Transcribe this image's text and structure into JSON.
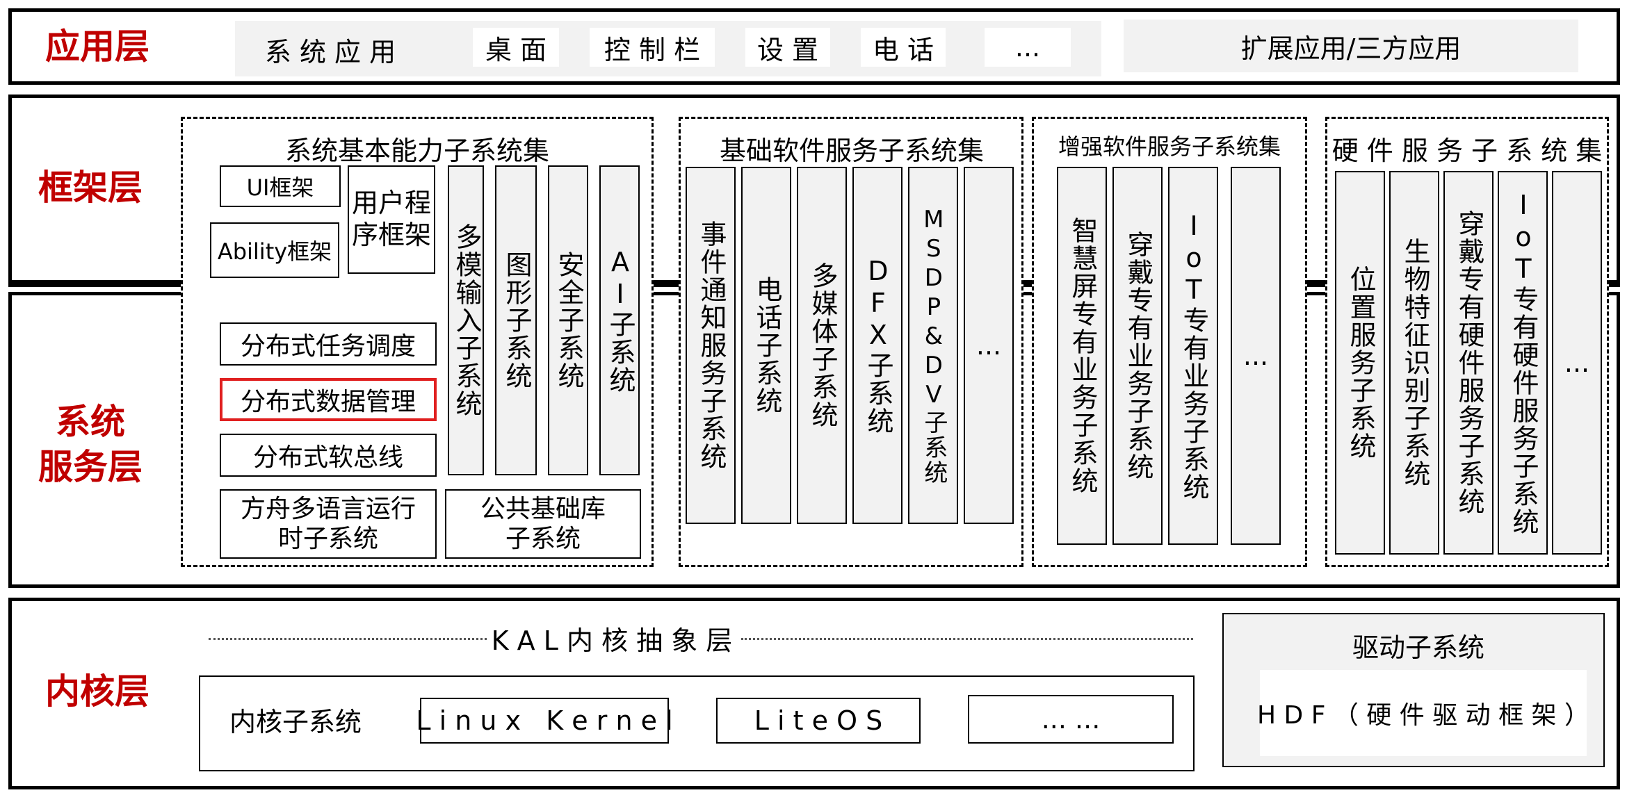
{
  "layers": {
    "app": "应用层",
    "framework": "框架层",
    "system_service": "系统\n服务层",
    "kernel": "内核层"
  },
  "app_layer": {
    "system_apps": "系 统 应 用",
    "items": [
      "桌 面",
      "控 制 栏",
      "设 置",
      "电 话",
      "..."
    ],
    "extended": "扩展应用/三方应用"
  },
  "basic_capability": {
    "title": "系统基本能力子系统集",
    "ui_framework": "UI框架",
    "ability_framework": "Ability框架",
    "user_program_framework": "用户程\n序框架",
    "columns": [
      "多模输入子系统",
      "图形子系统",
      "安全子系统",
      "AI子系统"
    ],
    "distributed": [
      "分布式任务调度",
      "分布式数据管理",
      "分布式软总线"
    ],
    "ark_runtime": "方舟多语言运行\n时子系统",
    "public_lib": "公共基础库\n子系统"
  },
  "basic_software": {
    "title": "基础软件服务子系统集",
    "columns": [
      "事件通知服务子系统",
      "电话子系统",
      "多媒体子系统",
      "DFX子系统",
      "MSDP&DV子系统",
      "..."
    ]
  },
  "enhanced_software": {
    "title": "增强软件服务子系统集",
    "columns": [
      "智慧屏专有业务子系统",
      "穿戴专有业务子系统",
      "IoT专有业务子系统",
      "..."
    ]
  },
  "hardware_service": {
    "title": "硬 件 服 务 子 系 统 集",
    "columns": [
      "位置服务子系统",
      "生物特征识别子系统",
      "穿戴专有硬件服务子系统",
      "IoT专有硬件服务子系统",
      "..."
    ]
  },
  "kernel_layer": {
    "kal": "K A L 内 核 抽 象 层",
    "kernel_subsystem": "内核子系统",
    "kernels": [
      "L i n u x   K e r n e l",
      "L i t e O S",
      "... ..."
    ],
    "driver_subsystem": "驱动子系统",
    "hdf": "H D F （ 硬 件 驱 动 框 架 ）"
  },
  "colors": {
    "highlight": "#e02020",
    "layer_label": "#c00000",
    "box_gray": "#f2f2f2"
  }
}
